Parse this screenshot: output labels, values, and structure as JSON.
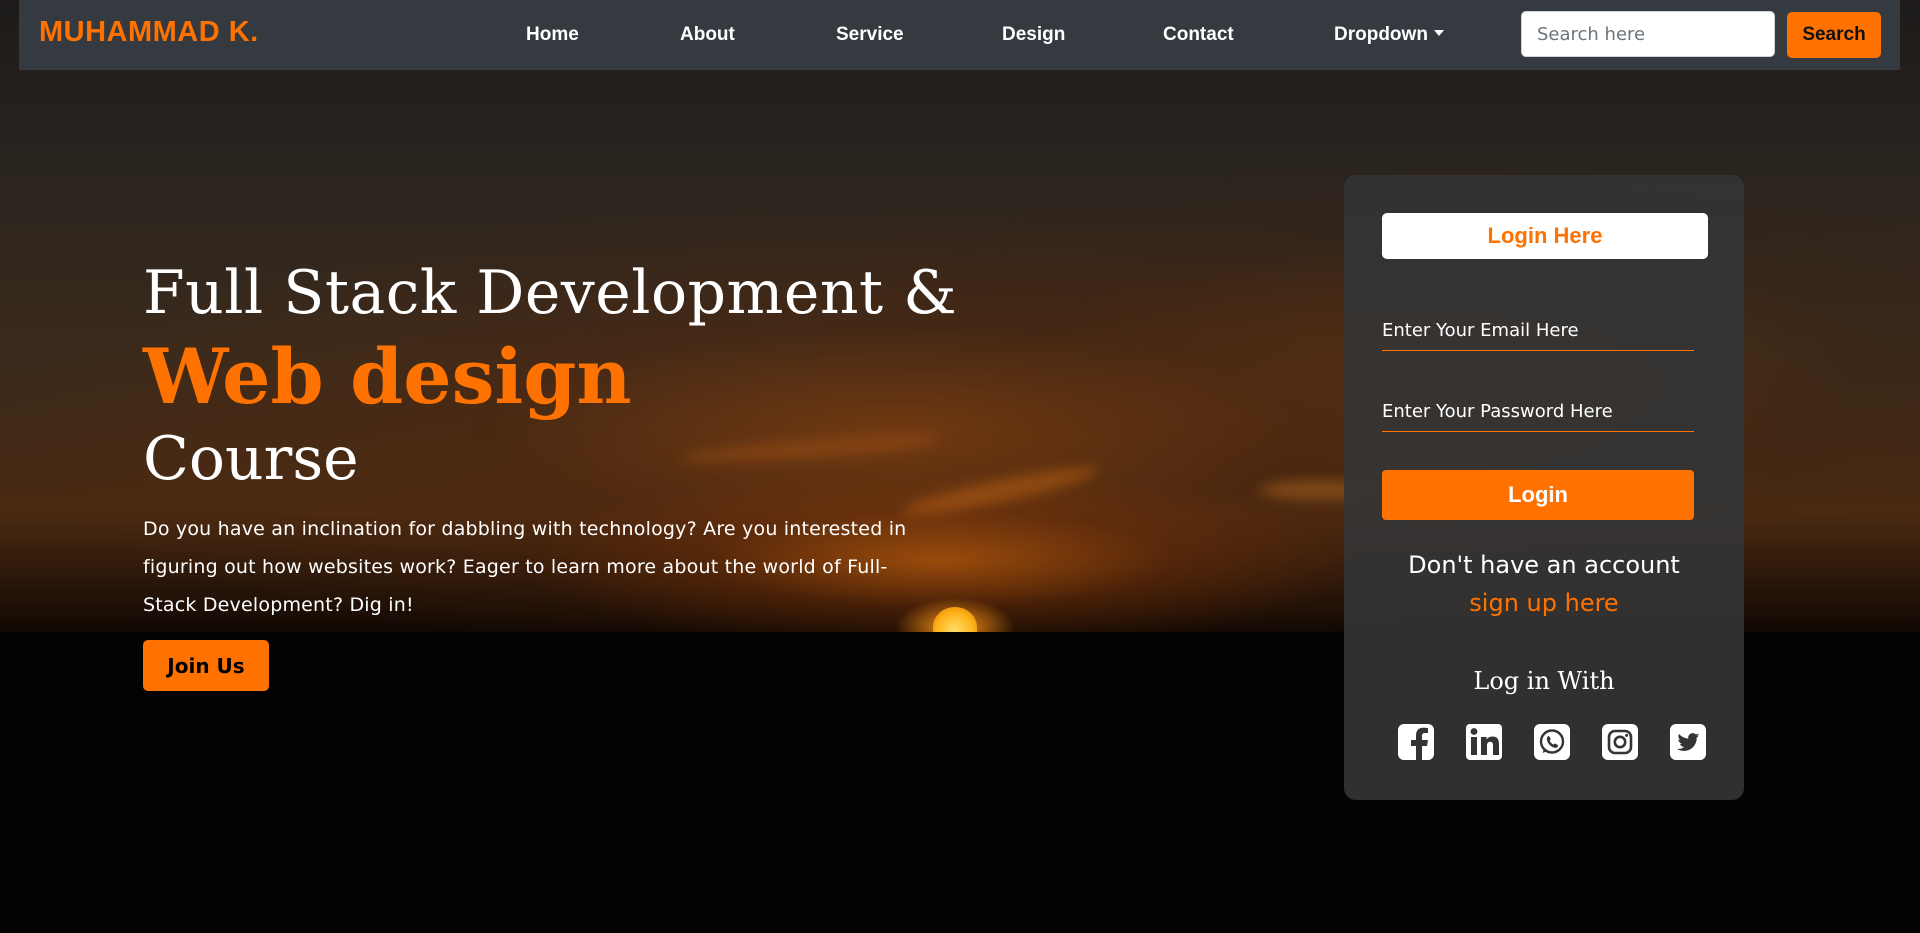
{
  "navbar": {
    "brand": "MUHAMMAD K.",
    "links": [
      {
        "label": "Home"
      },
      {
        "label": "About"
      },
      {
        "label": "Service"
      },
      {
        "label": "Design"
      },
      {
        "label": "Contact"
      },
      {
        "label": "Dropdown"
      }
    ],
    "search": {
      "placeholder": "Search here",
      "value": "",
      "button_label": "Search"
    }
  },
  "hero": {
    "line1": "Full Stack Development &",
    "line2": "Web design",
    "line3": "Course",
    "description": "Do you have an inclination for dabbling with technology? Are you interested in figuring out how websites work? Eager to learn more about the world of Full-Stack Development? Dig in!",
    "join_label": "Join Us"
  },
  "login": {
    "title": "Login Here",
    "email_placeholder": "Enter Your Email Here",
    "password_placeholder": "Enter Your Password Here",
    "login_label": "Login",
    "no_account_text": "Don't have an account",
    "signup_label": "sign up here",
    "login_with_label": "Log in With",
    "socials": [
      {
        "icon": "facebook-icon"
      },
      {
        "icon": "linkedin-icon"
      },
      {
        "icon": "whatsapp-icon"
      },
      {
        "icon": "instagram-icon"
      },
      {
        "icon": "twitter-icon"
      }
    ]
  },
  "colors": {
    "accent": "#ff7200",
    "navbar_bg": "#343a40",
    "card_bg": "#343434"
  }
}
